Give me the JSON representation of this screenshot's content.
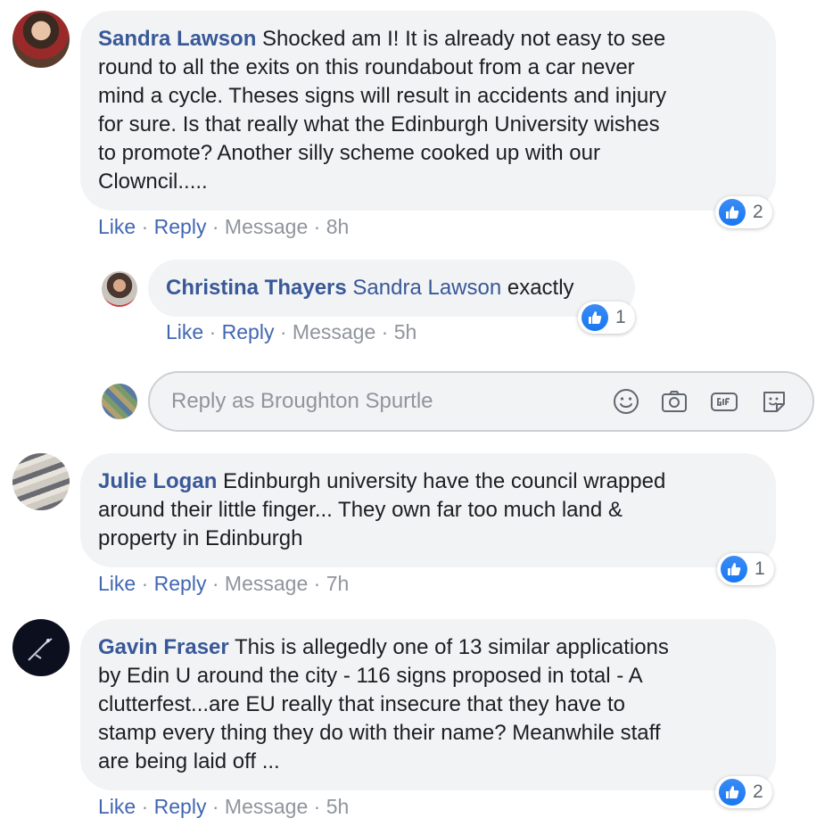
{
  "colors": {
    "author_link": "#385898",
    "action_link": "#4267b2",
    "muted": "#90949c",
    "bubble_bg": "#f2f3f5",
    "like_blue": "#1877f2"
  },
  "comments": [
    {
      "author": "Sandra Lawson",
      "text_lines": [
        " Shocked am I! It is already not easy to see",
        "round to all the exits on this roundabout from a car never",
        "mind a cycle. Theses signs will result in accidents and injury",
        "for sure. Is that really what the Edinburgh University wishes",
        "to promote? Another silly scheme cooked up with our",
        "Clowncil....."
      ],
      "like": "Like",
      "reply": "Reply",
      "message": "Message",
      "time": "8h",
      "reaction_count": "2",
      "reaction_icon": "like-icon",
      "reply_thread": {
        "author": "Christina Thayers",
        "mention": "Sandra Lawson",
        "text": " exactly",
        "like": "Like",
        "reply": "Reply",
        "message": "Message",
        "time": "5h",
        "reaction_count": "1"
      },
      "reply_box": {
        "placeholder": "Reply as Broughton Spurtle",
        "icons": [
          "emoji-icon",
          "camera-icon",
          "gif-icon",
          "sticker-icon"
        ]
      }
    },
    {
      "author": "Julie Logan",
      "text_lines": [
        " Edinburgh university have the council wrapped",
        "around their little finger... They own far too much land &",
        "property in Edinburgh"
      ],
      "like": "Like",
      "reply": "Reply",
      "message": "Message",
      "time": "7h",
      "reaction_count": "1"
    },
    {
      "author": "Gavin Fraser",
      "text_lines": [
        " This is allegedly one of 13 similar applications",
        "by Edin U around the city - 116 signs proposed in total - A",
        "clutterfest...are EU really that insecure that they have to",
        "stamp every thing they do with their name? Meanwhile staff",
        "are being laid off ..."
      ],
      "like": "Like",
      "reply": "Reply",
      "message": "Message",
      "time": "5h",
      "reaction_count": "2"
    }
  ],
  "separator": " · "
}
